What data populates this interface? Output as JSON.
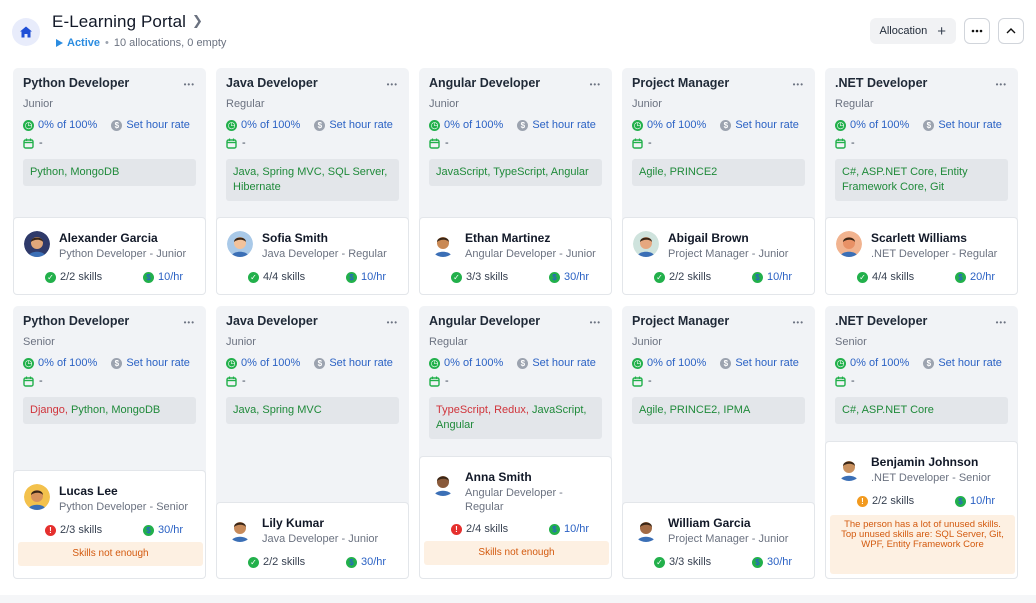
{
  "header": {
    "title": "E-Learning Portal",
    "status": "Active",
    "summary": "10 allocations, 0 empty",
    "allocation_label": "Allocation"
  },
  "colors": {
    "accent": "#2b62c4",
    "ok": "#1f8a3a",
    "bad": "#d0343b",
    "warn_bg": "#fdf0e2",
    "warn_text": "#d35a0f"
  },
  "cards": [
    {
      "title": "Python Developer",
      "level": "Junior",
      "pct": "0% of 100%",
      "rate_label": "Set hour rate",
      "date": "-",
      "skills": [
        {
          "text": "Python",
          "ok": true
        },
        {
          "text": "MongoDB",
          "ok": true
        }
      ],
      "person": {
        "name": "Alexander Garcia",
        "role": "Python Developer - Junior",
        "skills_count": "2/2 skills",
        "skills_status": "ok",
        "rate": "10/hr"
      }
    },
    {
      "title": "Java Developer",
      "level": "Regular",
      "pct": "0% of 100%",
      "rate_label": "Set hour rate",
      "date": "-",
      "skills": [
        {
          "text": "Java",
          "ok": true
        },
        {
          "text": "Spring MVC",
          "ok": true
        },
        {
          "text": "SQL Server",
          "ok": true
        },
        {
          "text": "Hibernate",
          "ok": true
        }
      ],
      "person": {
        "name": "Sofia Smith",
        "role": "Java Developer - Regular",
        "skills_count": "4/4 skills",
        "skills_status": "ok",
        "rate": "10/hr"
      }
    },
    {
      "title": "Angular Developer",
      "level": "Junior",
      "pct": "0% of 100%",
      "rate_label": "Set hour rate",
      "date": "-",
      "skills": [
        {
          "text": "JavaScript",
          "ok": true
        },
        {
          "text": "TypeScript",
          "ok": true
        },
        {
          "text": "Angular",
          "ok": true
        }
      ],
      "person": {
        "name": "Ethan Martinez",
        "role": "Angular Developer - Junior",
        "skills_count": "3/3 skills",
        "skills_status": "ok",
        "rate": "30/hr"
      }
    },
    {
      "title": "Project Manager",
      "level": "Junior",
      "pct": "0% of 100%",
      "rate_label": "Set hour rate",
      "date": "-",
      "skills": [
        {
          "text": "Agile",
          "ok": true
        },
        {
          "text": "PRINCE2",
          "ok": true
        }
      ],
      "person": {
        "name": "Abigail Brown",
        "role": "Project Manager - Junior",
        "skills_count": "2/2 skills",
        "skills_status": "ok",
        "rate": "10/hr"
      }
    },
    {
      "title": ".NET Developer",
      "level": "Regular",
      "pct": "0% of 100%",
      "rate_label": "Set hour rate",
      "date": "-",
      "skills": [
        {
          "text": "C#",
          "ok": true
        },
        {
          "text": "ASP.NET Core",
          "ok": true
        },
        {
          "text": "Entity Framework Core",
          "ok": true
        },
        {
          "text": "Git",
          "ok": true
        }
      ],
      "person": {
        "name": "Scarlett Williams",
        "role": ".NET Developer - Regular",
        "skills_count": "4/4 skills",
        "skills_status": "ok",
        "rate": "20/hr"
      }
    },
    {
      "title": "Python Developer",
      "level": "Senior",
      "pct": "0% of 100%",
      "rate_label": "Set hour rate",
      "date": "-",
      "skills": [
        {
          "text": "Django",
          "ok": false
        },
        {
          "text": "Python",
          "ok": true
        },
        {
          "text": "MongoDB",
          "ok": true
        }
      ],
      "person": {
        "name": "Lucas Lee",
        "role": "Python Developer - Senior",
        "skills_count": "2/3 skills",
        "skills_status": "bad",
        "rate": "30/hr",
        "warning": "Skills not enough"
      }
    },
    {
      "title": "Java Developer",
      "level": "Junior",
      "pct": "0% of 100%",
      "rate_label": "Set hour rate",
      "date": "-",
      "skills": [
        {
          "text": "Java",
          "ok": true
        },
        {
          "text": "Spring MVC",
          "ok": true
        }
      ],
      "person": {
        "name": "Lily Kumar",
        "role": "Java Developer - Junior",
        "skills_count": "2/2 skills",
        "skills_status": "ok",
        "rate": "30/hr"
      }
    },
    {
      "title": "Angular Developer",
      "level": "Regular",
      "pct": "0% of 100%",
      "rate_label": "Set hour rate",
      "date": "-",
      "skills": [
        {
          "text": "TypeScript",
          "ok": false
        },
        {
          "text": "Redux",
          "ok": false
        },
        {
          "text": "JavaScript",
          "ok": true
        },
        {
          "text": "Angular",
          "ok": true
        }
      ],
      "person": {
        "name": "Anna Smith",
        "role": "Angular Developer - Regular",
        "skills_count": "2/4 skills",
        "skills_status": "bad",
        "rate": "10/hr",
        "warning": "Skills not enough"
      }
    },
    {
      "title": "Project Manager",
      "level": "Junior",
      "pct": "0% of 100%",
      "rate_label": "Set hour rate",
      "date": "-",
      "skills": [
        {
          "text": "Agile",
          "ok": true
        },
        {
          "text": "PRINCE2",
          "ok": true
        },
        {
          "text": "IPMA",
          "ok": true
        }
      ],
      "person": {
        "name": "William Garcia",
        "role": "Project Manager - Junior",
        "skills_count": "3/3 skills",
        "skills_status": "ok",
        "rate": "30/hr"
      }
    },
    {
      "title": ".NET Developer",
      "level": "Senior",
      "pct": "0% of 100%",
      "rate_label": "Set hour rate",
      "date": "-",
      "skills": [
        {
          "text": "C#",
          "ok": true
        },
        {
          "text": "ASP.NET Core",
          "ok": true
        }
      ],
      "person": {
        "name": "Benjamin Johnson",
        "role": ".NET Developer - Senior",
        "skills_count": "2/2 skills",
        "skills_status": "warn",
        "rate": "10/hr",
        "warning": "The person has a lot of unused skills. Top unused skills are: SQL Server, Git, WPF, Entity Framework Core"
      }
    }
  ]
}
